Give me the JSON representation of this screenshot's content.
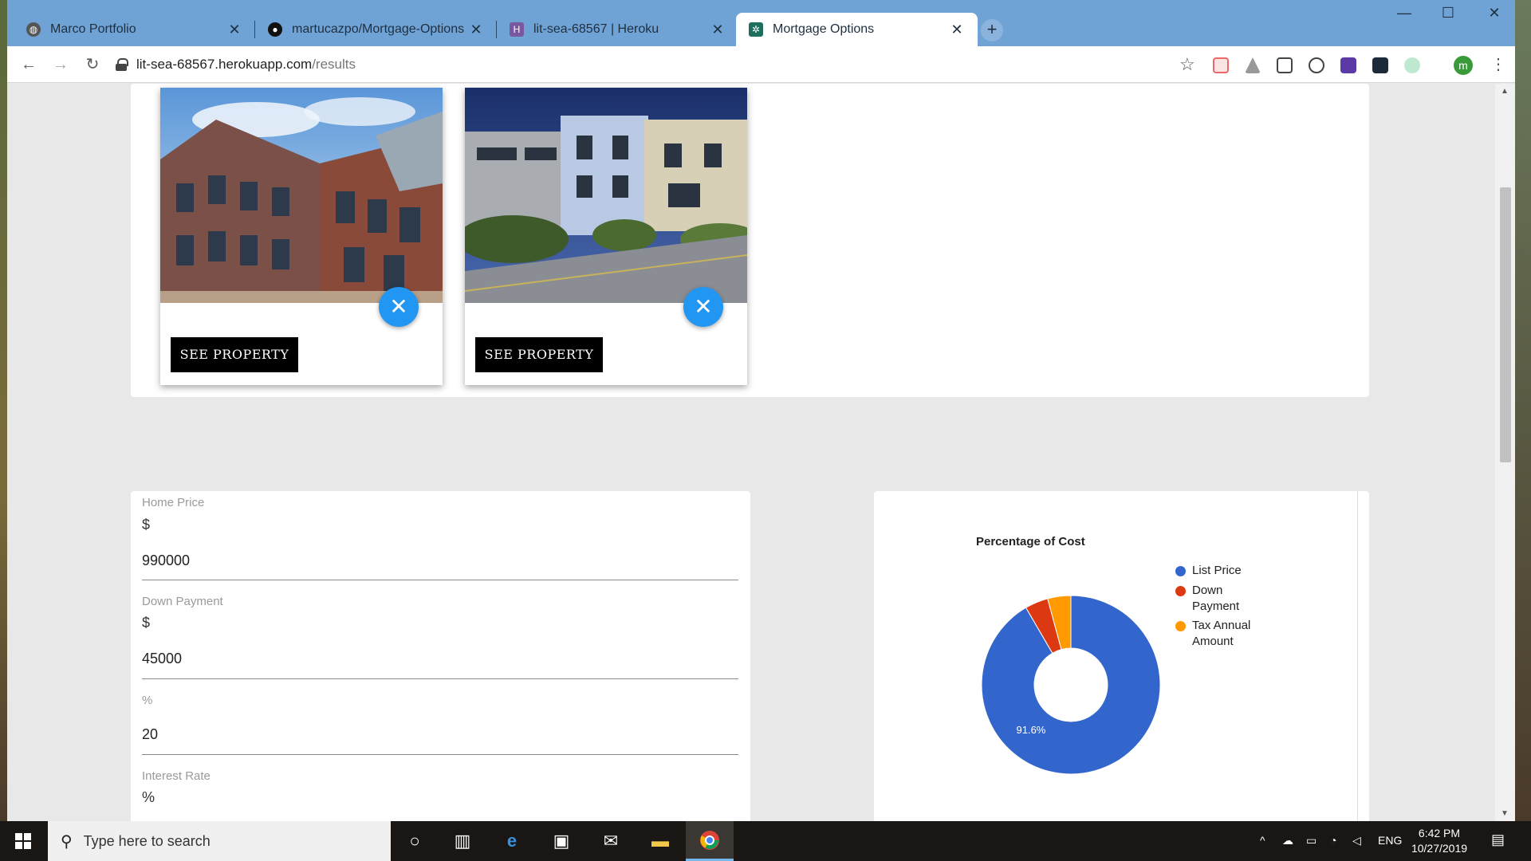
{
  "browser": {
    "tabs": [
      {
        "title": "Marco Portfolio",
        "close": "✕"
      },
      {
        "title": "martucazpo/Mortgage-Options",
        "close": "✕"
      },
      {
        "title": "lit-sea-68567 | Heroku",
        "close": "✕"
      },
      {
        "title": "Mortgage Options",
        "close": "✕"
      }
    ],
    "new_tab": "+",
    "url_host": "lit-sea-68567.herokuapp.com",
    "url_path": "/results",
    "profile_initial": "m"
  },
  "properties": {
    "cards": [
      {
        "button_label": "SEE PROPERTY",
        "close_icon": "✕"
      },
      {
        "button_label": "SEE PROPERTY",
        "close_icon": "✕"
      }
    ]
  },
  "form": {
    "home_price": {
      "label": "Home Price",
      "prefix": "$",
      "value": "990000"
    },
    "down_payment": {
      "label": "Down Payment",
      "prefix": "$",
      "value": "45000"
    },
    "down_percent": {
      "label": "%",
      "value": "20"
    },
    "interest_rate": {
      "label": "Interest Rate",
      "prefix": "%"
    }
  },
  "chart_data": {
    "type": "pie",
    "title": "Percentage of Cost",
    "donut": true,
    "labels": [
      "List Price",
      "Down Payment",
      "Tax Annual Amount"
    ],
    "values": [
      91.6,
      4.2,
      4.2
    ],
    "colors": [
      "#3366cc",
      "#dc3912",
      "#ff9900"
    ],
    "slice_labels": [
      "91.6%",
      "",
      ""
    ],
    "legend_position": "right"
  },
  "taskbar": {
    "search_placeholder": "Type here to search",
    "language": "ENG",
    "time": "6:42 PM",
    "date": "10/27/2019"
  }
}
